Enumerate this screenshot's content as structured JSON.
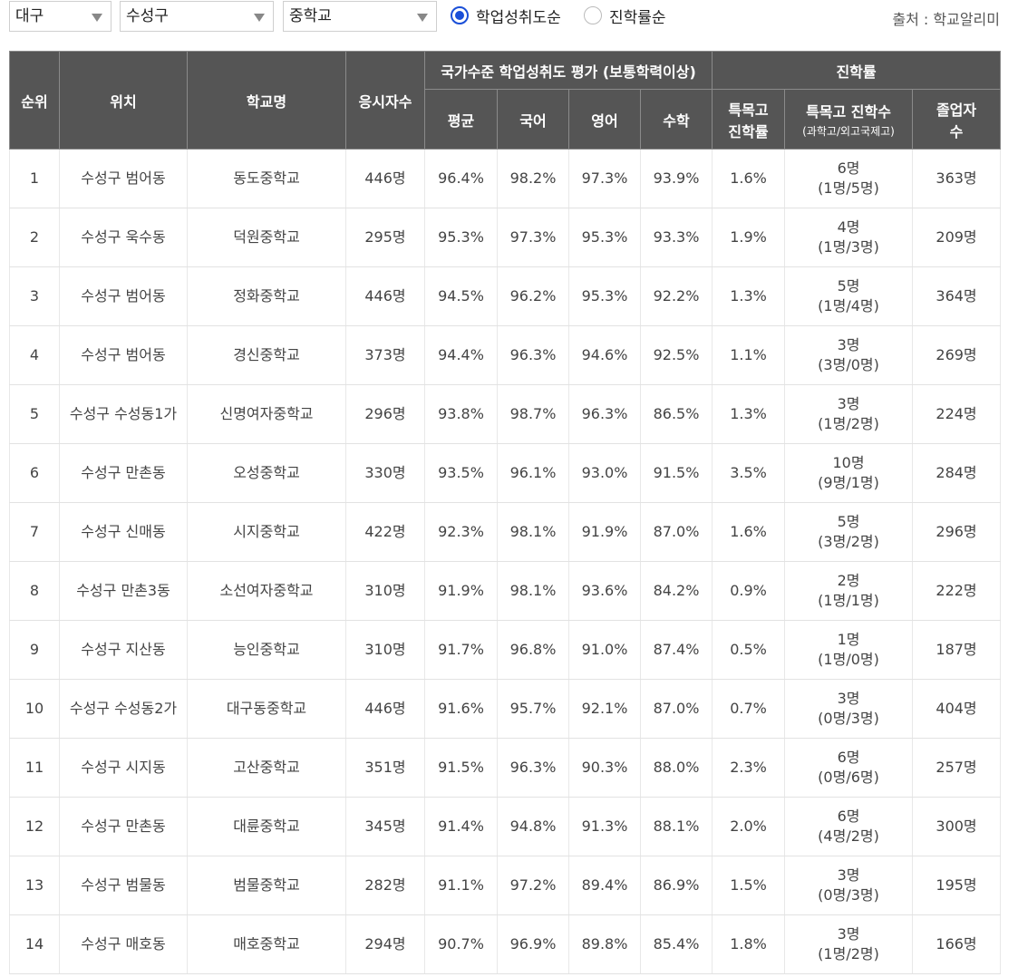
{
  "filters": {
    "region": "대구",
    "district": "수성구",
    "school_type": "중학교",
    "sort_options": [
      {
        "label": "학업성취도순",
        "selected": true
      },
      {
        "label": "진학률순",
        "selected": false
      }
    ],
    "source": "출처 : 학교알리미"
  },
  "colors": {
    "header_bg": "#555555",
    "radio_accent": "#1a4fd8"
  },
  "table": {
    "headers": {
      "rank": "순위",
      "location": "위치",
      "school": "학교명",
      "examinees": "응시자수",
      "achievement_group": "국가수준 학업성취도 평가 (보통학력이상)",
      "average": "평균",
      "korean": "국어",
      "english": "영어",
      "math": "수학",
      "admission_group": "진학률",
      "special_rate_1": "특목고",
      "special_rate_2": "진학률",
      "special_count_1": "특목고 진학수",
      "special_count_2": "(과학고/외고국제고)",
      "graduates_1": "졸업자",
      "graduates_2": "수"
    },
    "rows": [
      {
        "rank": "1",
        "location": "수성구 범어동",
        "school": "동도중학교",
        "examinees": "446명",
        "avg": "96.4%",
        "kor": "98.2%",
        "eng": "97.3%",
        "math": "93.9%",
        "special_rate": "1.6%",
        "special_count": "6명",
        "special_split": "(1명/5명)",
        "graduates": "363명"
      },
      {
        "rank": "2",
        "location": "수성구 욱수동",
        "school": "덕원중학교",
        "examinees": "295명",
        "avg": "95.3%",
        "kor": "97.3%",
        "eng": "95.3%",
        "math": "93.3%",
        "special_rate": "1.9%",
        "special_count": "4명",
        "special_split": "(1명/3명)",
        "graduates": "209명"
      },
      {
        "rank": "3",
        "location": "수성구 범어동",
        "school": "정화중학교",
        "examinees": "446명",
        "avg": "94.5%",
        "kor": "96.2%",
        "eng": "95.3%",
        "math": "92.2%",
        "special_rate": "1.3%",
        "special_count": "5명",
        "special_split": "(1명/4명)",
        "graduates": "364명"
      },
      {
        "rank": "4",
        "location": "수성구 범어동",
        "school": "경신중학교",
        "examinees": "373명",
        "avg": "94.4%",
        "kor": "96.3%",
        "eng": "94.6%",
        "math": "92.5%",
        "special_rate": "1.1%",
        "special_count": "3명",
        "special_split": "(3명/0명)",
        "graduates": "269명"
      },
      {
        "rank": "5",
        "location": "수성구 수성동1가",
        "school": "신명여자중학교",
        "examinees": "296명",
        "avg": "93.8%",
        "kor": "98.7%",
        "eng": "96.3%",
        "math": "86.5%",
        "special_rate": "1.3%",
        "special_count": "3명",
        "special_split": "(1명/2명)",
        "graduates": "224명"
      },
      {
        "rank": "6",
        "location": "수성구 만촌동",
        "school": "오성중학교",
        "examinees": "330명",
        "avg": "93.5%",
        "kor": "96.1%",
        "eng": "93.0%",
        "math": "91.5%",
        "special_rate": "3.5%",
        "special_count": "10명",
        "special_split": "(9명/1명)",
        "graduates": "284명"
      },
      {
        "rank": "7",
        "location": "수성구 신매동",
        "school": "시지중학교",
        "examinees": "422명",
        "avg": "92.3%",
        "kor": "98.1%",
        "eng": "91.9%",
        "math": "87.0%",
        "special_rate": "1.6%",
        "special_count": "5명",
        "special_split": "(3명/2명)",
        "graduates": "296명"
      },
      {
        "rank": "8",
        "location": "수성구 만촌3동",
        "school": "소선여자중학교",
        "examinees": "310명",
        "avg": "91.9%",
        "kor": "98.1%",
        "eng": "93.6%",
        "math": "84.2%",
        "special_rate": "0.9%",
        "special_count": "2명",
        "special_split": "(1명/1명)",
        "graduates": "222명"
      },
      {
        "rank": "9",
        "location": "수성구 지산동",
        "school": "능인중학교",
        "examinees": "310명",
        "avg": "91.7%",
        "kor": "96.8%",
        "eng": "91.0%",
        "math": "87.4%",
        "special_rate": "0.5%",
        "special_count": "1명",
        "special_split": "(1명/0명)",
        "graduates": "187명"
      },
      {
        "rank": "10",
        "location": "수성구 수성동2가",
        "school": "대구동중학교",
        "examinees": "446명",
        "avg": "91.6%",
        "kor": "95.7%",
        "eng": "92.1%",
        "math": "87.0%",
        "special_rate": "0.7%",
        "special_count": "3명",
        "special_split": "(0명/3명)",
        "graduates": "404명"
      },
      {
        "rank": "11",
        "location": "수성구 시지동",
        "school": "고산중학교",
        "examinees": "351명",
        "avg": "91.5%",
        "kor": "96.3%",
        "eng": "90.3%",
        "math": "88.0%",
        "special_rate": "2.3%",
        "special_count": "6명",
        "special_split": "(0명/6명)",
        "graduates": "257명"
      },
      {
        "rank": "12",
        "location": "수성구 만촌동",
        "school": "대륜중학교",
        "examinees": "345명",
        "avg": "91.4%",
        "kor": "94.8%",
        "eng": "91.3%",
        "math": "88.1%",
        "special_rate": "2.0%",
        "special_count": "6명",
        "special_split": "(4명/2명)",
        "graduates": "300명"
      },
      {
        "rank": "13",
        "location": "수성구 범물동",
        "school": "범물중학교",
        "examinees": "282명",
        "avg": "91.1%",
        "kor": "97.2%",
        "eng": "89.4%",
        "math": "86.9%",
        "special_rate": "1.5%",
        "special_count": "3명",
        "special_split": "(0명/3명)",
        "graduates": "195명"
      },
      {
        "rank": "14",
        "location": "수성구 매호동",
        "school": "매호중학교",
        "examinees": "294명",
        "avg": "90.7%",
        "kor": "96.9%",
        "eng": "89.8%",
        "math": "85.4%",
        "special_rate": "1.8%",
        "special_count": "3명",
        "special_split": "(1명/2명)",
        "graduates": "166명"
      }
    ]
  }
}
